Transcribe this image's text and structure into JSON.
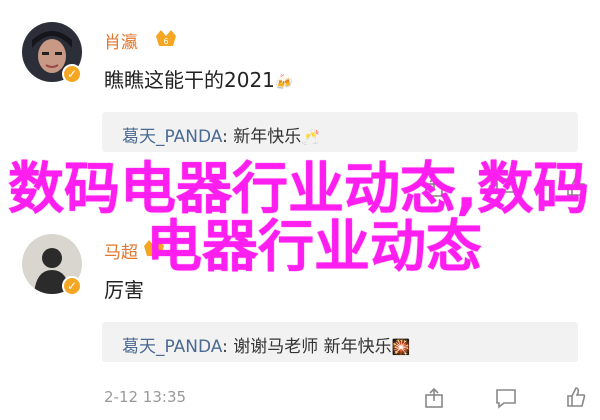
{
  "comments": [
    {
      "username": "肖瀛",
      "text": "瞧瞧这能干的2021",
      "text_emoji": "beer-mug-emoji",
      "reply_user": "葛天_PANDA",
      "reply_sep": ":",
      "reply_text": "新年快乐",
      "reply_emoji": "clinking-glasses-emoji",
      "timestamp": "2-12 13:35"
    },
    {
      "username": "马超",
      "text": "厉害",
      "reply_user": "葛天_PANDA",
      "reply_sep": ":",
      "reply_text": "谢谢马老师 新年快乐",
      "reply_emoji": "sparkler-emoji",
      "timestamp": "2-12 13:35"
    }
  ],
  "watermark": {
    "line1": "数码电器行业动态,数码",
    "line2": "电器行业动态"
  },
  "colors": {
    "username": "#e0762f",
    "reply_user": "#4a6a92",
    "watermark": "#ff1ef0",
    "verified": "#f5a623"
  }
}
